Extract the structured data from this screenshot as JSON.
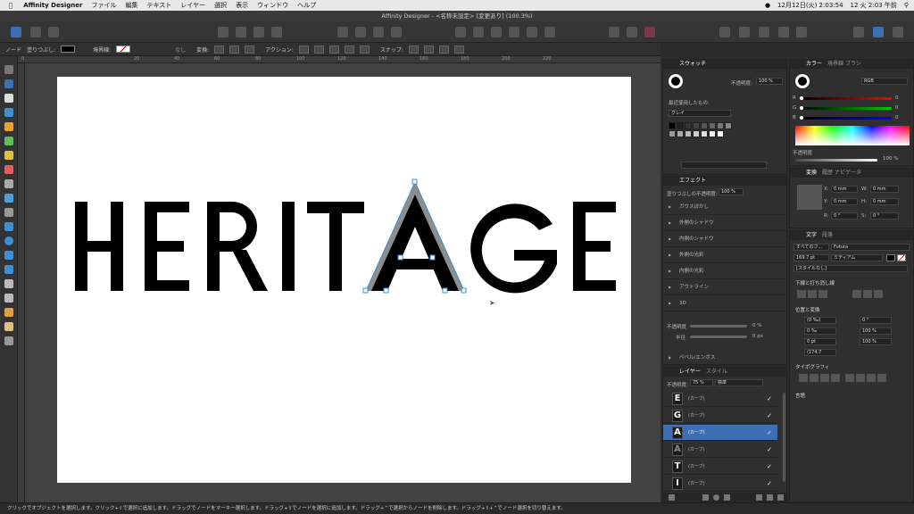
{
  "menubar": {
    "app": "Affinity Designer",
    "items": [
      "ファイル",
      "編集",
      "テキスト",
      "レイヤー",
      "選択",
      "表示",
      "ウィンドウ",
      "ヘルプ"
    ],
    "clock": "12月12日(火) 2:03:54",
    "date_badge": "12 火 2:03 午前"
  },
  "window": {
    "title": "Affinity Designer - <名称未設定> [変更あり] (100.3%)"
  },
  "context_toolbar": {
    "mode": "ノード",
    "fill_label": "塗りつぶし:",
    "stroke_label": "境界線:",
    "none": "なし",
    "transform": "変換:",
    "action": "アクション:",
    "snap": "スナップ:"
  },
  "ruler": {
    "ticks": [
      "0",
      "20",
      "40",
      "60",
      "80",
      "100",
      "120",
      "140",
      "160",
      "180",
      "200",
      "220"
    ]
  },
  "canvas": {
    "artwork_text": "HERITAGE"
  },
  "swatches_panel": {
    "tab": "スウォッチ",
    "opacity_label": "不透明度:",
    "opacity": "100 %",
    "recent_label": "最近使用したもの:",
    "palette": "グレイ"
  },
  "color_panel": {
    "tabs": [
      "カラー",
      "境界線",
      "ブラシ"
    ],
    "model": "RGB",
    "r_label": "R",
    "g_label": "G",
    "b_label": "B",
    "r": "0",
    "g": "0",
    "b": "0",
    "opacity_label": "不透明度",
    "opacity": "100 %"
  },
  "effects_panel": {
    "tab": "エフェクト",
    "fill_opacity_label": "塗りつぶしの不透明度:",
    "fill_opacity": "100 %",
    "items": [
      "ガウスぼかし",
      "外側のシャドウ",
      "内側のシャドウ",
      "外側の光彩",
      "内側の光彩",
      "アウトライン",
      "3D"
    ],
    "opacity_label": "不透明度",
    "opacity_value": "0 %",
    "radius_label": "半径",
    "radius_value": "0 px",
    "bevel": "ベベル/エンボス"
  },
  "layers_panel": {
    "tabs": [
      "レイヤー",
      "スタイル"
    ],
    "opacity_label": "不透明度:",
    "opacity": "75 %",
    "blend": "標準",
    "rows": [
      {
        "thumb": "E",
        "name": "(カーブ)"
      },
      {
        "thumb": "G",
        "name": "(カーブ)"
      },
      {
        "thumb": "A",
        "name": "(カーブ)"
      },
      {
        "thumb": "A",
        "name": "(カーブ)"
      },
      {
        "thumb": "T",
        "name": "(カーブ)"
      },
      {
        "thumb": "I",
        "name": "(カーブ)"
      }
    ]
  },
  "transform_panel": {
    "tabs": [
      "変換",
      "履歴",
      "ナビゲータ"
    ],
    "x_label": "X:",
    "y_label": "Y:",
    "w_label": "W:",
    "h_label": "H:",
    "r_label": "R:",
    "s_label": "S:",
    "x": "0 mm",
    "y": "0 mm",
    "w": "0 mm",
    "h": "0 mm",
    "r": "0 °",
    "s": "0 °"
  },
  "text_panel": {
    "tabs": [
      "文字",
      "段落"
    ],
    "family_scope": "すべてのフ...",
    "font": "Futura",
    "size": "169.7 pt",
    "weight": "ミディアム",
    "style": "[スタイルなし]",
    "underline_section": "下線と打ち消し線",
    "position_section": "位置と変換",
    "kern": "(0 ‰)",
    "track": "0 ‰",
    "baseline": "0 pt",
    "leading": "(174.7",
    "angle": "0 °",
    "hscale": "100 %",
    "vscale": "100 %",
    "typo_section": "タイポグラフィ",
    "lang_section": "言語"
  },
  "statusbar": {
    "text": "クリックでオブジェクトを選択します。クリック+⇧で選択に追加します。ドラッグでノードをマーキー選択します。ドラッグ+⇧でノードを選択に追加します。ドラッグ+⌃で選択からノードを削除します。ドラッグ+⇧+⌃でノード選択を切り替えます。"
  }
}
